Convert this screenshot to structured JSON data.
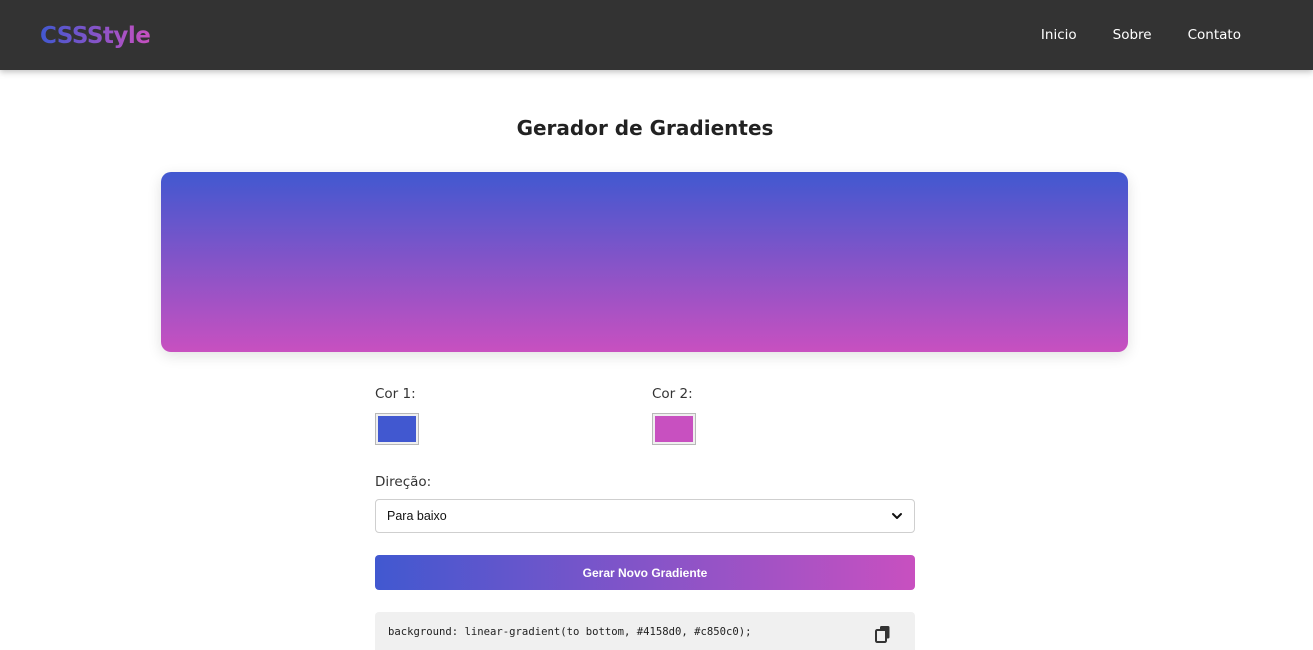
{
  "nav": {
    "logo": "CSSStyle",
    "links": [
      "Inicio",
      "Sobre",
      "Contato"
    ]
  },
  "page": {
    "title": "Gerador de Gradientes"
  },
  "controls": {
    "color1_label": "Cor 1:",
    "color1_value": "#4158d0",
    "color2_label": "Cor 2:",
    "color2_value": "#c850c0",
    "direction_label": "Direção:",
    "direction_value": "Para baixo",
    "generate_label": "Gerar Novo Gradiente"
  },
  "output": {
    "css_code": "background: linear-gradient(to bottom, #4158d0, #c850c0);",
    "copy_icon": "copy-icon"
  },
  "colors": {
    "navbar_bg": "#333333",
    "gradient_start": "#4158d0",
    "gradient_end": "#c850c0"
  }
}
